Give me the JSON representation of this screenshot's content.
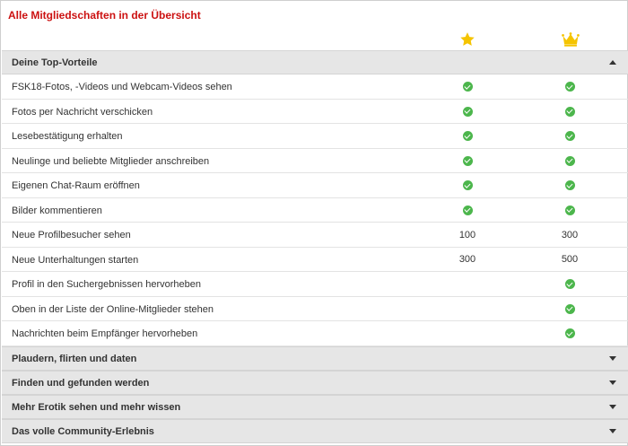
{
  "page": {
    "title": "Alle Mitgliedschaften in der Übersicht",
    "tier_icons": [
      "star-icon",
      "crown-icon"
    ],
    "accent_color": "#cc1111",
    "icon_color": "#f5c400",
    "check_color": "#4cb64c"
  },
  "top_section": {
    "label": "Deine Top-Vorteile",
    "expanded": true,
    "rows": [
      {
        "label": "FSK18-Fotos, -Videos und Webcam-Videos sehen",
        "col1": "check",
        "col2": "check"
      },
      {
        "label": "Fotos per Nachricht verschicken",
        "col1": "check",
        "col2": "check"
      },
      {
        "label": "Lesebestätigung erhalten",
        "col1": "check",
        "col2": "check"
      },
      {
        "label": "Neulinge und beliebte Mitglieder anschreiben",
        "col1": "check",
        "col2": "check"
      },
      {
        "label": "Eigenen Chat-Raum eröffnen",
        "col1": "check",
        "col2": "check"
      },
      {
        "label": "Bilder kommentieren",
        "col1": "check",
        "col2": "check"
      },
      {
        "label": "Neue Profilbesucher sehen",
        "col1": "100",
        "col2": "300"
      },
      {
        "label": "Neue Unterhaltungen starten",
        "col1": "300",
        "col2": "500"
      },
      {
        "label": "Profil in den Suchergebnissen hervorheben",
        "col1": "",
        "col2": "check"
      },
      {
        "label": "Oben in der Liste der Online-Mitglieder stehen",
        "col1": "",
        "col2": "check"
      },
      {
        "label": "Nachrichten beim Empfänger hervorheben",
        "col1": "",
        "col2": "check"
      }
    ]
  },
  "collapsed_sections": [
    {
      "label": "Plaudern, flirten und daten"
    },
    {
      "label": "Finden und gefunden werden"
    },
    {
      "label": "Mehr Erotik sehen und mehr wissen"
    },
    {
      "label": "Das volle Community-Erlebnis"
    }
  ]
}
